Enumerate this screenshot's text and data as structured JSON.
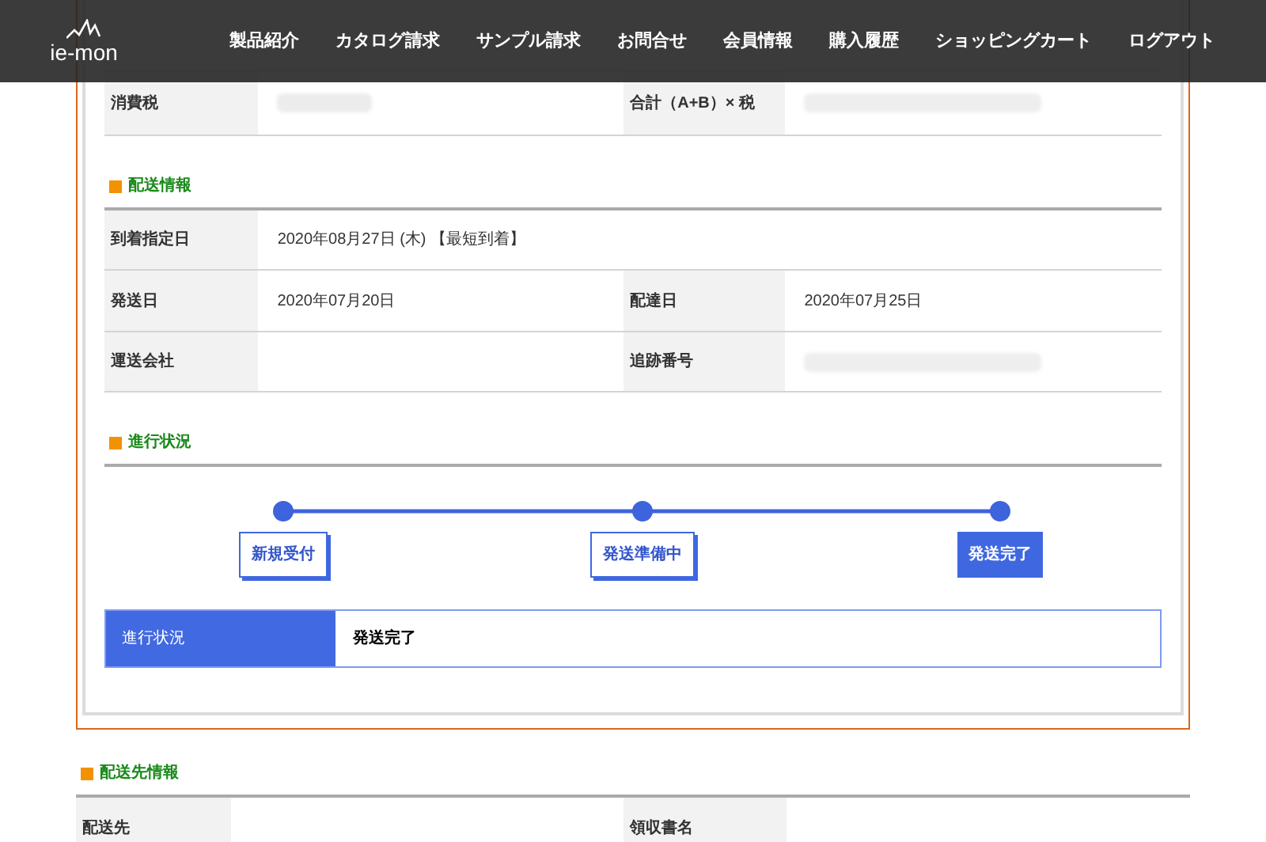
{
  "nav": {
    "logo": "ie-mon",
    "items": [
      "製品紹介",
      "カタログ請求",
      "サンプル請求",
      "お問合せ",
      "会員情報",
      "購入履歴",
      "ショッピングカート",
      "ログアウト"
    ]
  },
  "totals": {
    "rows": [
      [
        {
          "label": "消費税",
          "blurred": true
        },
        {
          "label": "合計（A+B）× 税",
          "blurred": true
        }
      ]
    ]
  },
  "shipping": {
    "heading": "配送情報",
    "rows": [
      [
        {
          "label": "到着指定日",
          "value": "2020年08月27日 (木) 【最短到着】"
        }
      ],
      [
        {
          "label": "発送日",
          "value": "2020年07月20日"
        },
        {
          "label": "配達日",
          "value": "2020年07月25日"
        }
      ],
      [
        {
          "label": "運送会社"
        },
        {
          "label": "追跡番号",
          "blurred": true
        }
      ]
    ]
  },
  "progress": {
    "heading": "進行状況",
    "steps": [
      {
        "label": "新規受付",
        "selected": false
      },
      {
        "label": "発送準備中",
        "selected": false
      },
      {
        "label": "発送完了",
        "selected": true
      }
    ],
    "status_label": "進行状況",
    "status_value": "発送完了"
  },
  "destination": {
    "heading": "配送先情報",
    "rows": [
      [
        {
          "label": "配送先"
        },
        {
          "label": "領収書名"
        }
      ]
    ]
  }
}
